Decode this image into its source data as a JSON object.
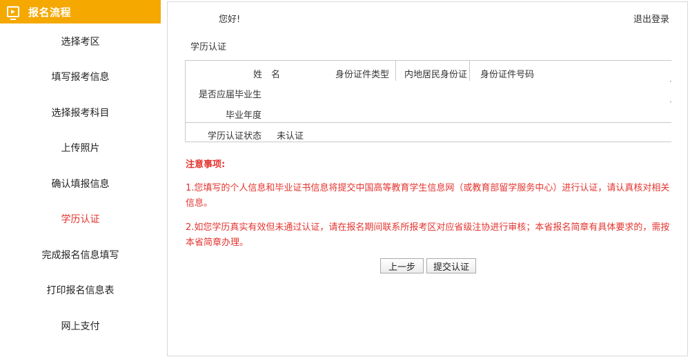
{
  "sidebar": {
    "header_title": "报名流程",
    "items": [
      {
        "label": "选择考区",
        "active": false
      },
      {
        "label": "填写报考信息",
        "active": false
      },
      {
        "label": "选择报考科目",
        "active": false
      },
      {
        "label": "上传照片",
        "active": false
      },
      {
        "label": "确认填报信息",
        "active": false
      },
      {
        "label": "学历认证",
        "active": true
      },
      {
        "label": "完成报名信息填写",
        "active": false
      },
      {
        "label": "打印报名信息表",
        "active": false
      },
      {
        "label": "网上支付",
        "active": false
      }
    ]
  },
  "header": {
    "greeting": "您好!",
    "logout": "退出登录"
  },
  "section_title": "学历认证",
  "info": {
    "name_label": "姓　名",
    "name_value": "",
    "id_type_label": "身份证件类型",
    "id_type_value": "内地居民身份证",
    "id_number_label": "身份证件号码",
    "id_number_value": "",
    "fresh_grad_label": "是否应届毕业生",
    "fresh_grad_value": "",
    "grad_year_label": "毕业年度",
    "grad_year_value": "",
    "status_label": "学历认证状态",
    "status_value": "未认证"
  },
  "notice": {
    "title": "注意事项:",
    "p1": "1.您填写的个人信息和毕业证书信息将提交中国高等教育学生信息网（或教育部留学服务中心）进行认证，请认真核对相关信息。",
    "p2": "2.如您学历真实有效但未通过认证，请在报名期间联系所报考区对应省级注协进行审核；本省报名简章有具体要求的，需按本省简章办理。"
  },
  "buttons": {
    "prev": "上一步",
    "submit": "提交认证"
  },
  "colors": {
    "accent": "#f5a800",
    "active_text": "#e3342f",
    "notice_text": "#e3342f"
  },
  "icons": {
    "header_icon": "monitor-play-icon"
  }
}
